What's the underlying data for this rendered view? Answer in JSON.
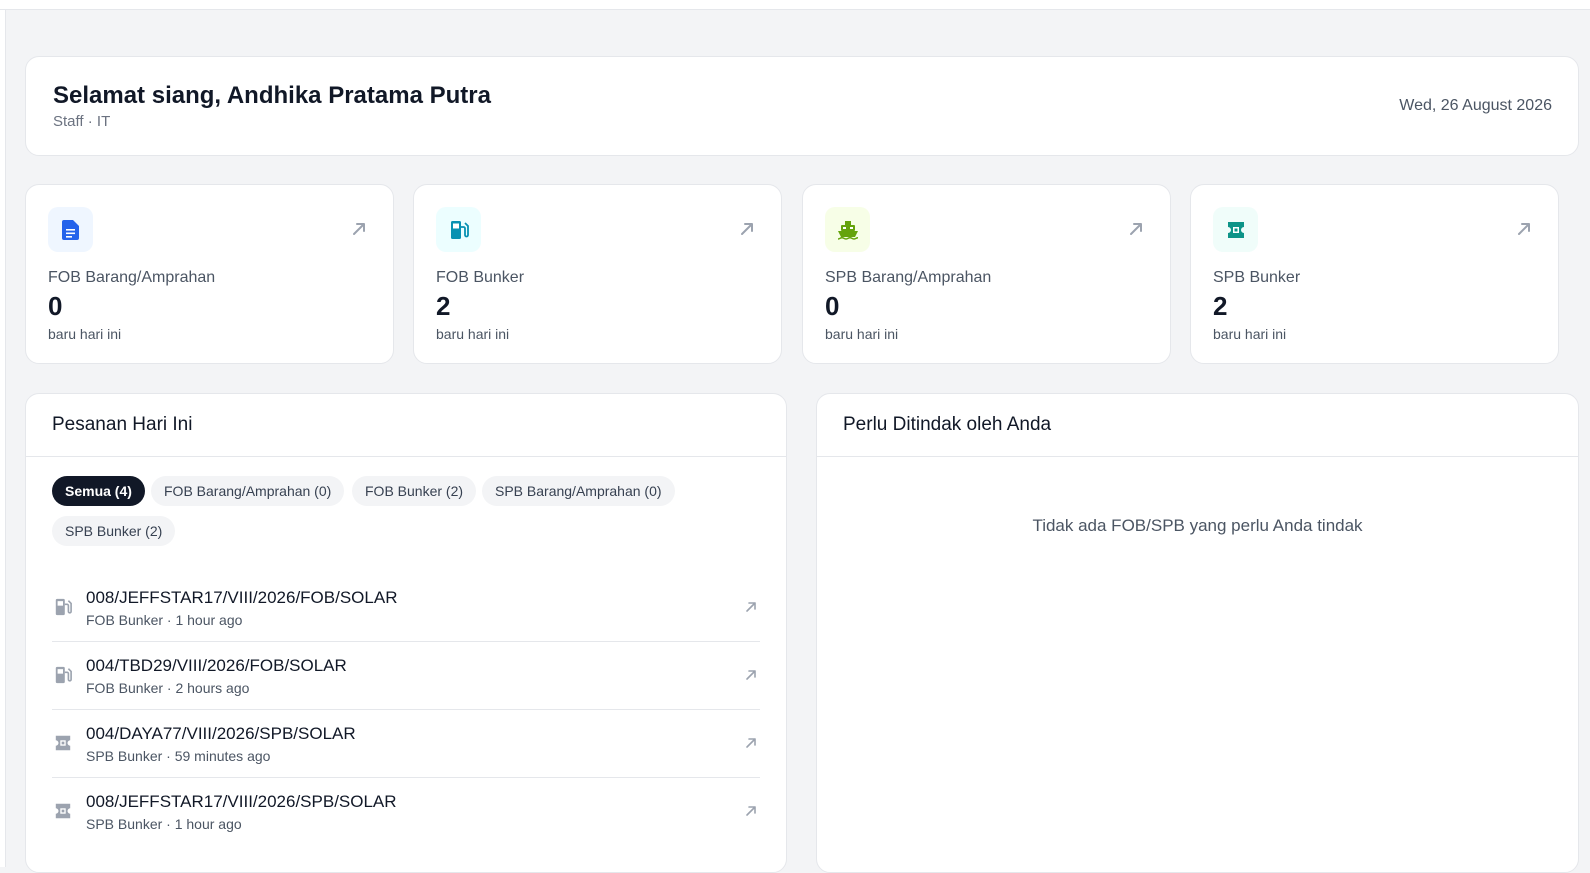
{
  "greeting": {
    "title": "Selamat siang, Andhika Pratama Putra",
    "subtitle": "Staff · IT",
    "date": "Wed, 26 August 2026"
  },
  "stats": [
    {
      "label": "FOB Barang/Amprahan",
      "value": "0",
      "sub": "baru hari ini",
      "icon": "document-icon",
      "color": "#2563eb",
      "bg": "#eff6ff"
    },
    {
      "label": "FOB Bunker",
      "value": "2",
      "sub": "baru hari ini",
      "icon": "fuel-pump-icon",
      "color": "#0891b2",
      "bg": "#ecfeff"
    },
    {
      "label": "SPB Barang/Amprahan",
      "value": "0",
      "sub": "baru hari ini",
      "icon": "ship-icon",
      "color": "#65a30d",
      "bg": "#f7fee7"
    },
    {
      "label": "SPB Bunker",
      "value": "2",
      "sub": "baru hari ini",
      "icon": "ticket-icon",
      "color": "#0d9488",
      "bg": "#f0fdfa"
    }
  ],
  "orders": {
    "title": "Pesanan Hari Ini",
    "filters": [
      {
        "label": "Semua (4)",
        "active": true
      },
      {
        "label": "FOB Barang/Amprahan (0)",
        "active": false
      },
      {
        "label": "FOB Bunker (2)",
        "active": false
      },
      {
        "label": "SPB Barang/Amprahan (0)",
        "active": false
      },
      {
        "label": "SPB Bunker (2)",
        "active": false
      }
    ],
    "items": [
      {
        "title": "008/JEFFSTAR17/VIII/2026/FOB/SOLAR",
        "sub": "FOB Bunker · 1 hour ago",
        "icon": "fuel-pump-icon"
      },
      {
        "title": "004/TBD29/VIII/2026/FOB/SOLAR",
        "sub": "FOB Bunker · 2 hours ago",
        "icon": "fuel-pump-icon"
      },
      {
        "title": "004/DAYA77/VIII/2026/SPB/SOLAR",
        "sub": "SPB Bunker · 59 minutes ago",
        "icon": "ticket-icon"
      },
      {
        "title": "008/JEFFSTAR17/VIII/2026/SPB/SOLAR",
        "sub": "SPB Bunker · 1 hour ago",
        "icon": "ticket-icon"
      }
    ]
  },
  "todo": {
    "title": "Perlu Ditindak oleh Anda",
    "empty": "Tidak ada FOB/SPB yang perlu Anda tindak"
  }
}
